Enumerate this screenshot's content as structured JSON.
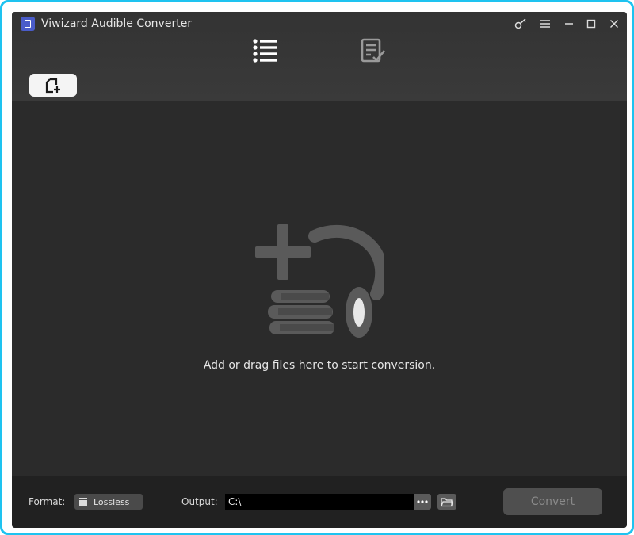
{
  "app": {
    "title": "Viwizard Audible Converter",
    "accent_color": "#1ec3f0"
  },
  "window_controls": [
    {
      "name": "key-icon"
    },
    {
      "name": "menu-icon"
    },
    {
      "name": "minimize-icon"
    },
    {
      "name": "maximize-icon"
    },
    {
      "name": "close-icon"
    }
  ],
  "tabs": [
    {
      "name": "list",
      "icon": "list-icon",
      "active": true
    },
    {
      "name": "converted",
      "icon": "converted-list-icon",
      "active": false
    }
  ],
  "toolbar": {
    "add_files_icon": "add-file-icon"
  },
  "main": {
    "empty_message": "Add or drag files here to start conversion.",
    "illustration": "add-audiobooks-illustration"
  },
  "bottom": {
    "format_label": "Format:",
    "format_value": "Lossless",
    "output_label": "Output:",
    "output_path": "C:\\",
    "more_label": "•••",
    "convert_label": "Convert"
  }
}
